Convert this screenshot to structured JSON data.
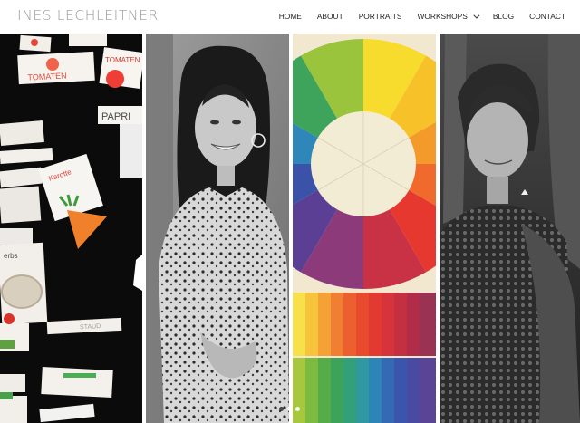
{
  "brand": {
    "logo_text": "INES LECHLEITNER"
  },
  "nav": {
    "items": [
      {
        "label": "HOME"
      },
      {
        "label": "ABOUT"
      },
      {
        "label": "PORTRAITS"
      },
      {
        "label": "WORKSHOPS",
        "has_dropdown": true
      },
      {
        "label": "BLOG"
      },
      {
        "label": "CONTACT"
      }
    ]
  },
  "gallery": {
    "panel1": {
      "labels": [
        "TOMATEN",
        "TOMATEN",
        "PAPRI",
        "Karotte",
        "erbs",
        "STAUD"
      ]
    },
    "slider_dots": {
      "count": 3,
      "active_index": 0
    }
  },
  "colors": {
    "logo": "#9a9a9a",
    "nav_text": "#222222",
    "background": "#ffffff"
  }
}
